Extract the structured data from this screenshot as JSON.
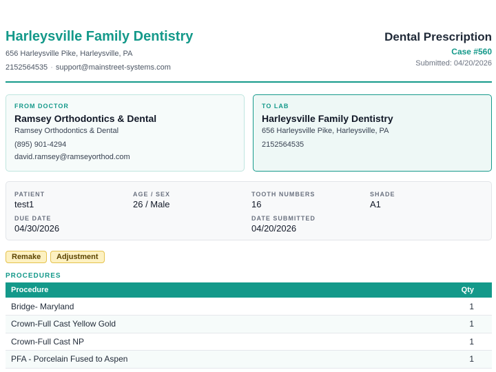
{
  "practice": {
    "name": "Harleysville Family Dentistry",
    "address": "656 Harleysville Pike, Harleysville, PA",
    "phone": "2152564535",
    "email": "support@mainstreet-systems.com",
    "separator": "·"
  },
  "document": {
    "title": "Dental Prescription",
    "case": "Case #560",
    "submitted": "Submitted: 04/20/2026"
  },
  "from_doctor": {
    "label": "FROM DOCTOR",
    "name": "Ramsey Orthodontics & Dental",
    "practice": "Ramsey Orthodontics & Dental",
    "phone": "(895) 901-4294",
    "email": "david.ramsey@ramseyorthod.com"
  },
  "to_lab": {
    "label": "TO LAB",
    "name": "Harleysville Family Dentistry",
    "address": "656 Harleysville Pike, Harleysville, PA",
    "phone": "2152564535"
  },
  "details": {
    "patient_label": "PATIENT",
    "patient": "test1",
    "age_sex_label": "AGE / SEX",
    "age_sex": "26 / Male",
    "teeth_label": "TOOTH NUMBERS",
    "teeth": "16",
    "shade_label": "SHADE",
    "shade": "A1",
    "due_label": "DUE DATE",
    "due": "04/30/2026",
    "submitted_label": "DATE SUBMITTED",
    "submitted": "04/20/2026"
  },
  "tags": [
    "Remake",
    "Adjustment"
  ],
  "colors": {
    "accent": "#14998a",
    "tag_bg": "#fdf1c2",
    "tag_border": "#e4c24c"
  },
  "procedures": {
    "title": "PROCEDURES",
    "columns": {
      "procedure": "Procedure",
      "qty": "Qty"
    },
    "rows": [
      {
        "name": "Bridge- Maryland",
        "qty": "1"
      },
      {
        "name": "Crown-Full Cast Yellow Gold",
        "qty": "1"
      },
      {
        "name": "Crown-Full Cast NP",
        "qty": "1"
      },
      {
        "name": "PFA - Porcelain Fused to Aspen",
        "qty": "1"
      }
    ]
  }
}
